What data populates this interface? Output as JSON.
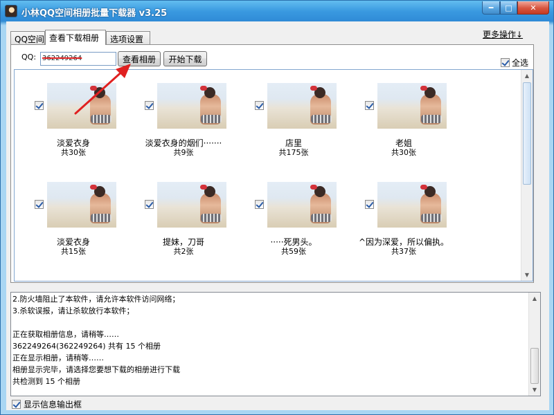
{
  "window": {
    "title": "小林QQ空间相册批量下载器 v3.25",
    "controls": {
      "minimize": "━",
      "maximize": "□",
      "close": "✕"
    }
  },
  "tabs": [
    {
      "label": "QQ空间",
      "active": false
    },
    {
      "label": "查看下载相册",
      "active": true
    },
    {
      "label": "选项设置",
      "active": false
    }
  ],
  "more_ops": "更多操作↓",
  "form": {
    "qq_label": "QQ:",
    "qq_value": "362249264",
    "view_button": "查看相册",
    "start_button": "开始下载",
    "select_all_label": "全选",
    "select_all_checked": true
  },
  "albums": [
    {
      "name": "淡爱衣身",
      "count": "共30张",
      "checked": true
    },
    {
      "name": "淡爱衣身的烟们·······",
      "count": "共9张",
      "checked": true
    },
    {
      "name": "店里",
      "count": "共175张",
      "checked": true
    },
    {
      "name": "老姐",
      "count": "共30张",
      "checked": true
    },
    {
      "name": "淡爱衣身",
      "count": "共15张",
      "checked": true
    },
    {
      "name": "提妹，刀哥",
      "count": "共2张",
      "checked": true
    },
    {
      "name": "·····死男头。",
      "count": "共59张",
      "checked": true
    },
    {
      "name": "^因为深爱，所以偏执。",
      "count": "共37张",
      "checked": true
    }
  ],
  "log": {
    "lines": [
      "2.防火墙阻止了本软件，请允许本软件访问网络；",
      "3.杀软误报，请让杀软放行本软件；",
      "",
      "正在获取相册信息，请稍等……",
      "362249264(362249264) 共有 15 个相册",
      "正在显示相册，请稍等……",
      "相册显示完毕，请选择您要想下载的相册进行下载",
      "共检测到 15 个相册"
    ]
  },
  "footer": {
    "show_output_label": "显示信息输出框",
    "show_output_checked": true
  },
  "colors": {
    "title_bar": "#3a9ae0",
    "close_button": "#d7553f",
    "annotation_arrow": "#e02020"
  }
}
